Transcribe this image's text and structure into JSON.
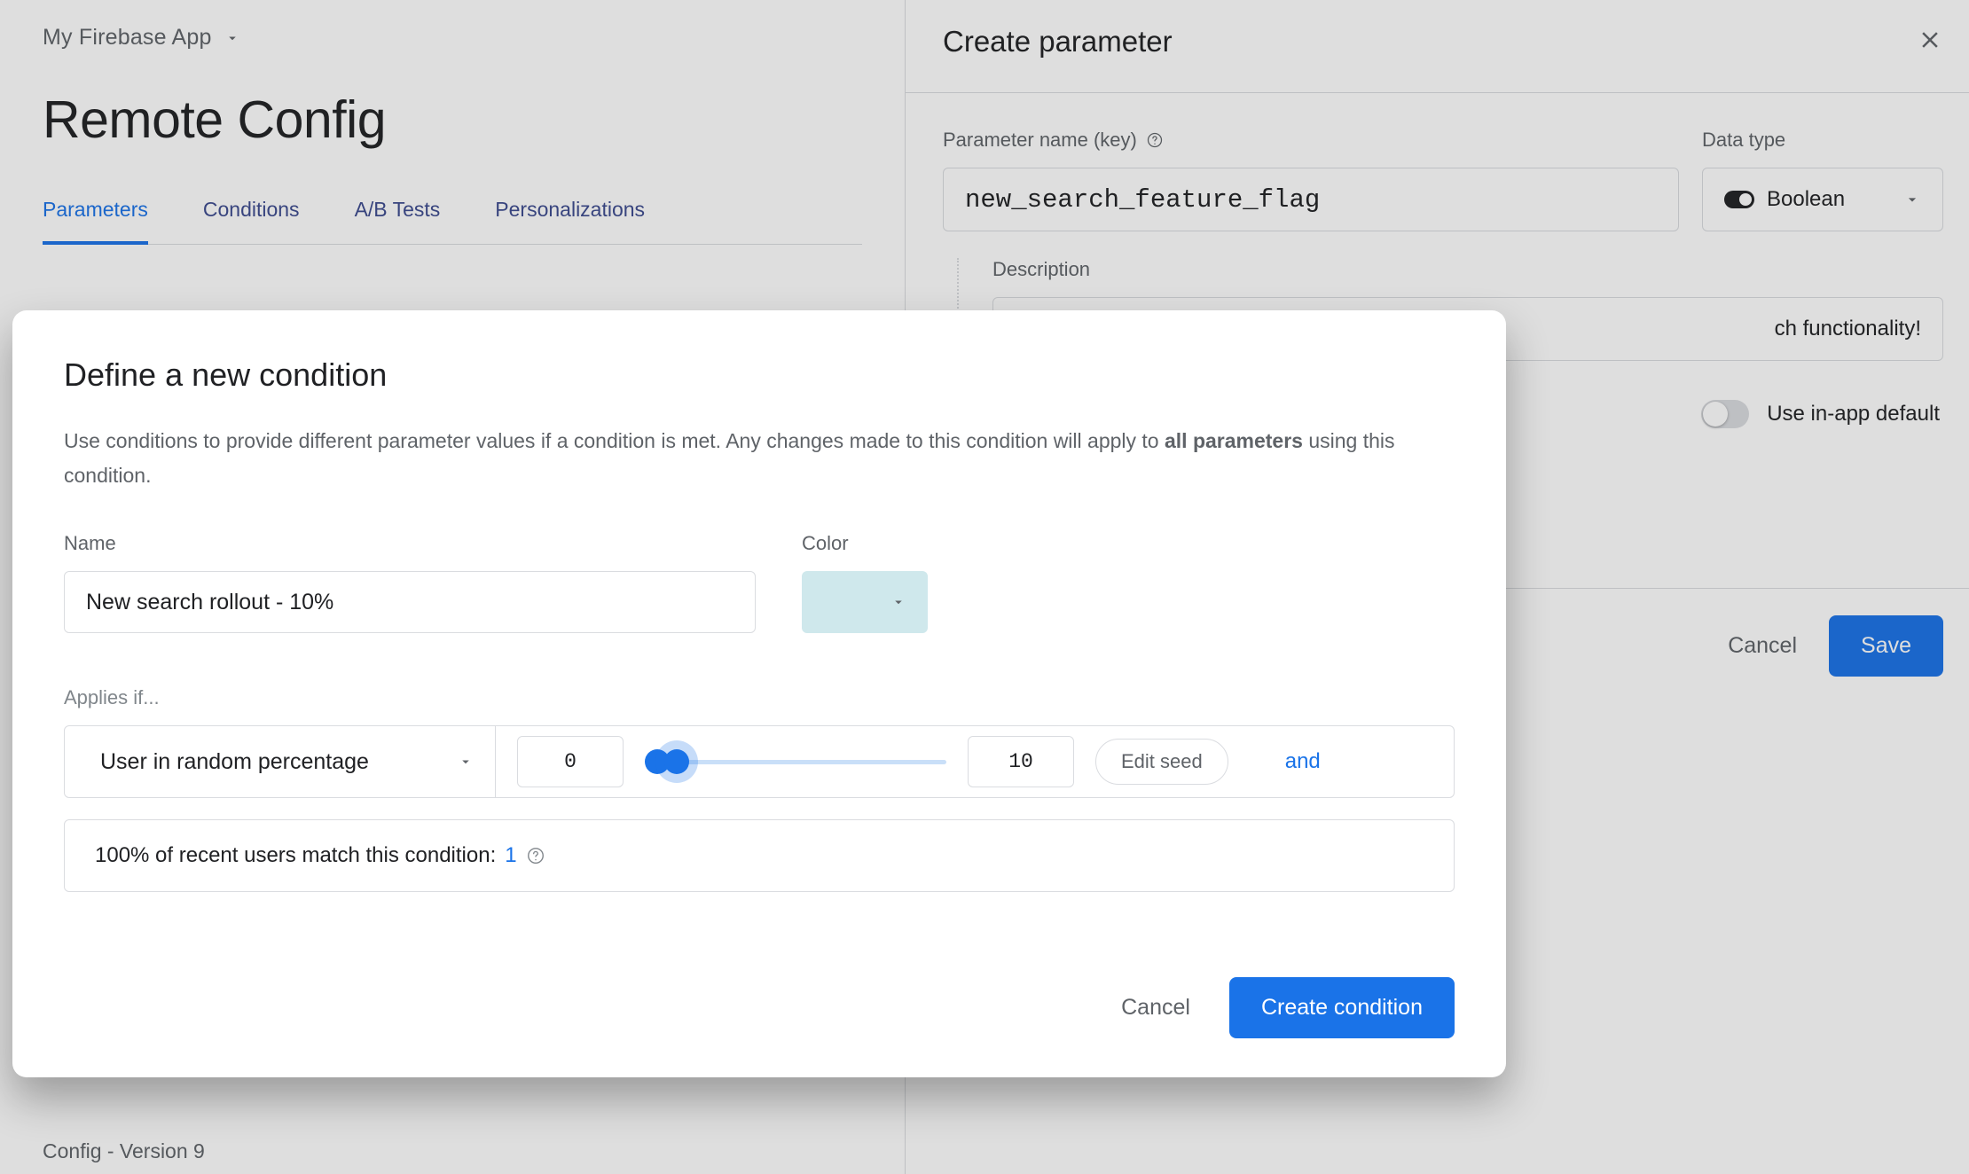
{
  "page": {
    "app_name": "My Firebase App",
    "title": "Remote Config",
    "tabs": [
      "Parameters",
      "Conditions",
      "A/B Tests",
      "Personalizations"
    ],
    "active_tab": 0,
    "footer": "Config - Version 9"
  },
  "panel": {
    "title": "Create parameter",
    "param_label": "Parameter name (key)",
    "param_value": "new_search_feature_flag",
    "datatype_label": "Data type",
    "datatype_value": "Boolean",
    "desc_label": "Description",
    "desc_value_suffix": "ch functionality!",
    "in_app_default_label": "Use in-app default",
    "cancel": "Cancel",
    "save": "Save"
  },
  "dialog": {
    "title": "Define a new condition",
    "desc_part1": "Use conditions to provide different parameter values if a condition is met. Any changes made to this condition will apply to ",
    "desc_bold": "all parameters",
    "desc_part2": " using this condition.",
    "name_label": "Name",
    "name_value": "New search rollout - 10%",
    "color_label": "Color",
    "applies_label": "Applies if...",
    "rule_condition": "User in random percentage",
    "range_lo": "0",
    "range_hi": "10",
    "edit_seed": "Edit seed",
    "and": "and",
    "match_text": "100% of recent users match this condition: ",
    "match_count": "1",
    "cancel": "Cancel",
    "create": "Create condition"
  }
}
